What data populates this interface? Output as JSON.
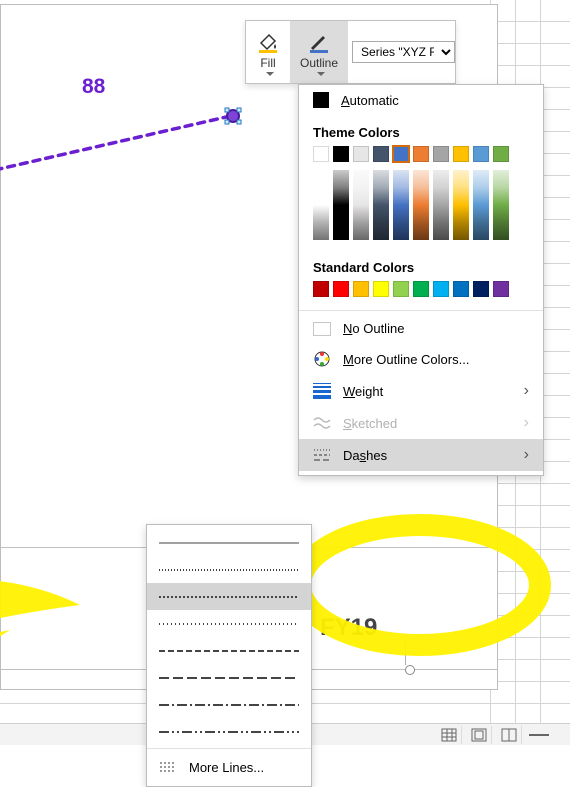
{
  "toolbar": {
    "fill_label": "Fill",
    "outline_label": "Outline",
    "series_selected": "Series \"XYZ Rat"
  },
  "outline_menu": {
    "automatic": "Automatic",
    "theme_title": "Theme Colors",
    "standard_title": "Standard Colors",
    "no_outline": "No Outline",
    "more_colors": "More Outline Colors...",
    "weight": "Weight",
    "sketched": "Sketched",
    "dashes": "Dashes",
    "theme_main": [
      "#ffffff",
      "#000000",
      "#e7e6e6",
      "#44546a",
      "#4472c4",
      "#ed7d31",
      "#a5a5a5",
      "#ffc000",
      "#5b9bd5",
      "#70ad47"
    ],
    "selected_theme_index": 4,
    "standard": [
      "#c00000",
      "#ff0000",
      "#ffc000",
      "#ffff00",
      "#92d050",
      "#00b050",
      "#00b0f0",
      "#0070c0",
      "#002060",
      "#7030a0"
    ]
  },
  "dash_flyout": {
    "more_lines": "More Lines...",
    "selected_index": 2,
    "patterns": [
      "1 0",
      "1 2",
      "2 2",
      "1 3",
      "6 3",
      "10 4",
      "10 3 2 3",
      "10 3 2 3 2 3"
    ]
  },
  "chart_data": {
    "type": "line",
    "title": "",
    "series": [
      {
        "name": "XYZ Rat",
        "values": [
          88
        ]
      }
    ],
    "point_label": "88",
    "axis_labels": [
      "FY19"
    ],
    "line_style": "dashed",
    "line_color": "#6a1fd0"
  },
  "statusbar": {
    "views": [
      "normal",
      "page-layout",
      "page-break"
    ]
  }
}
